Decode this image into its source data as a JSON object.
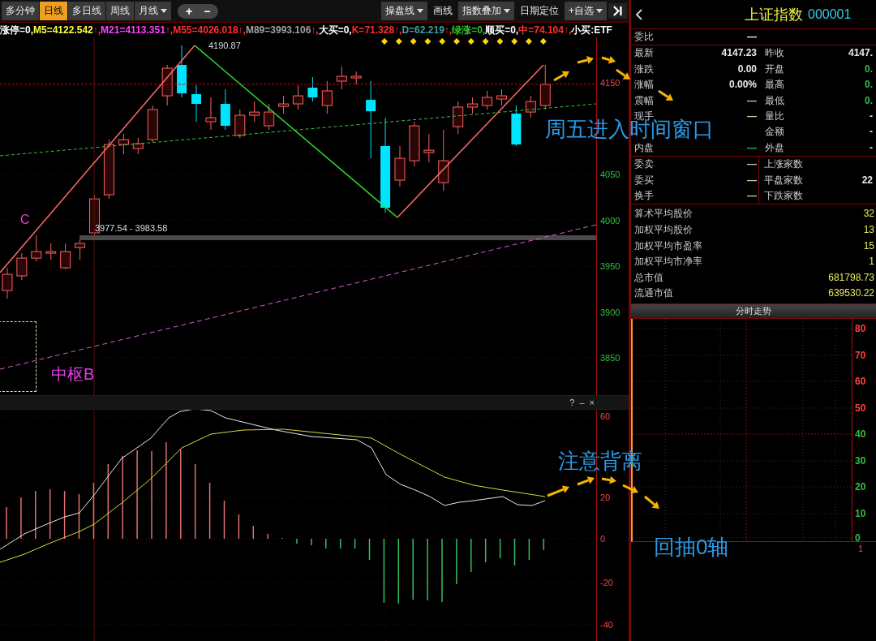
{
  "toolbar": {
    "period_tabs": [
      {
        "label": "多分钟",
        "selected": false,
        "dropdown": false
      },
      {
        "label": "日线",
        "selected": true,
        "dropdown": false
      },
      {
        "label": "多日线",
        "selected": false,
        "dropdown": false
      },
      {
        "label": "周线",
        "selected": false,
        "dropdown": false
      },
      {
        "label": "月线",
        "selected": false,
        "dropdown": true
      }
    ],
    "zoom_buttons": [
      "+",
      "−"
    ],
    "tools": [
      {
        "label": "操盘线",
        "dropdown": true
      },
      {
        "label": "画线",
        "dropdown": false
      },
      {
        "label": "指数叠加",
        "dropdown": true
      },
      {
        "label": "日期定位",
        "dropdown": false
      },
      {
        "label": "+自选",
        "dropdown": true
      }
    ]
  },
  "indicators": [
    {
      "text": "涨停=0,",
      "color": "#ffffff"
    },
    {
      "text": "M5=4122.542",
      "color": "#ffff40",
      "trend": "↑,"
    },
    {
      "text": "M21=4113.351",
      "color": "#ff40ff",
      "trend": "↑,"
    },
    {
      "text": "M55=4026.018",
      "color": "#ff3030",
      "trend": "↑,"
    },
    {
      "text": "M89=3993.106",
      "color": "#a0a0a0",
      "trend": "↑,"
    },
    {
      "text": "大买=0,",
      "color": "#ffffff"
    },
    {
      "text": "K=71.328",
      "color": "#ff3030",
      "trend": "↑,"
    },
    {
      "text": "D=62.219",
      "color": "#40a0a0",
      "trend": "↑,"
    },
    {
      "text": "绿涨=0,",
      "color": "#30c030"
    },
    {
      "text": "顺买=0,",
      "color": "#ffffff"
    },
    {
      "text": "中=74.104",
      "color": "#ff3030",
      "trend": "↑,"
    },
    {
      "text": "小买:",
      "color": "#ffffff"
    },
    {
      "text": "ETF",
      "color": "#ffffff"
    }
  ],
  "price_chart": {
    "high_label": "4190.87",
    "range_label": "3977.54 - 3983.58",
    "chart_data": {
      "type": "candlestick",
      "categories": [
        null,
        null,
        null,
        null,
        null,
        null,
        null,
        null,
        null,
        null,
        null,
        null,
        null,
        null,
        null,
        null,
        null,
        null,
        null,
        null,
        null,
        null,
        null,
        null,
        null,
        null,
        null,
        null,
        null,
        null,
        null,
        null,
        null,
        null,
        null,
        null,
        null,
        null,
        null,
        null,
        null
      ],
      "ohlc": [
        [
          3923.4,
          3948.2,
          3914.6,
          3941.1
        ],
        [
          3939.4,
          3964.1,
          3934.9,
          3958.8
        ],
        [
          3958.8,
          3983.6,
          3955.3,
          3965.9
        ],
        [
          3964.1,
          3974.8,
          3957.1,
          3965.9
        ],
        [
          3948.2,
          3974.8,
          3946.4,
          3965.9
        ],
        [
          3970.3,
          3979.2,
          3957.1,
          3974.8
        ],
        [
          3986.3,
          4027.9,
          3983.6,
          4023.4
        ],
        [
          4027.9,
          4088.0,
          4023.4,
          4082.7
        ],
        [
          4082.7,
          4094.2,
          4072.1,
          4088.0
        ],
        [
          4078.3,
          4089.8,
          4072.1,
          4083.6
        ],
        [
          4088.0,
          4125.2,
          4085.4,
          4120.8
        ],
        [
          4135.8,
          4169.5,
          4125.2,
          4165.9
        ],
        [
          4169.5,
          4190.87,
          4134.1,
          4138.5
        ],
        [
          4137.6,
          4147.3,
          4107.5,
          4127.0
        ],
        [
          4107.5,
          4134.1,
          4098.7,
          4111.9
        ],
        [
          4127.0,
          4142.9,
          4098.7,
          4103.1
        ],
        [
          4092.5,
          4120.8,
          4089.8,
          4114.6
        ],
        [
          4114.6,
          4129.6,
          4107.5,
          4118.1
        ],
        [
          4103.1,
          4127.0,
          4098.7,
          4118.1
        ],
        [
          4124.3,
          4135.8,
          4116.4,
          4127.0
        ],
        [
          4127.0,
          4147.3,
          4120.8,
          4135.8
        ],
        [
          4144.7,
          4156.2,
          4129.6,
          4134.1
        ],
        [
          4125.2,
          4151.8,
          4116.4,
          4141.2
        ],
        [
          4151.8,
          4167.7,
          4142.9,
          4157.1
        ],
        [
          4155.3,
          4162.4,
          4148.2,
          4157.1
        ],
        [
          4131.4,
          4151.8,
          4067.7,
          4119.0
        ],
        [
          4081.0,
          4111.9,
          4008.4,
          4013.7
        ],
        [
          4043.8,
          4081.0,
          4036.7,
          4067.7
        ],
        [
          4065.0,
          4107.5,
          4058.8,
          4103.1
        ],
        [
          4073.9,
          4094.2,
          4063.3,
          4076.5
        ],
        [
          4041.1,
          4098.7,
          4032.3,
          4065.0
        ],
        [
          4102.2,
          4129.6,
          4094.2,
          4123.5
        ],
        [
          4123.5,
          4134.1,
          4116.4,
          4127.0
        ],
        [
          4125.2,
          4141.2,
          4120.8,
          4134.1
        ],
        [
          4132.3,
          4142.9,
          4125.2,
          4135.8
        ],
        [
          4116.4,
          4125.2,
          4081.0,
          4082.7
        ],
        [
          4118.1,
          4135.8,
          4111.9,
          4129.6
        ],
        [
          4125.2,
          4169.5,
          4120.8,
          4148.2
        ],
        null,
        null,
        null
      ],
      "grid": true,
      "ylim": [
        3809.3,
        4199.6
      ],
      "yticks": [
        4150,
        4050,
        4000,
        3950,
        3900,
        3850
      ]
    }
  },
  "macd_panel": {
    "controls": [
      "?",
      "–",
      "×"
    ],
    "axis": [
      "60",
      "20",
      "0",
      "-20",
      "-40"
    ]
  },
  "annotations": [
    {
      "text": "C",
      "color": "#e040e0"
    },
    {
      "text": "中枢B",
      "color": "#e040e0"
    },
    {
      "text": "周五进入时间窗口",
      "color": "#2a9be8"
    },
    {
      "text": "注意背离",
      "color": "#2a9be8"
    },
    {
      "text": "回抽0轴",
      "color": "#2a9be8"
    }
  ],
  "quote_panel": {
    "title": "上证指数",
    "code": "000001",
    "ratio": {
      "label": "委比",
      "value": "—"
    },
    "rows": [
      {
        "left": {
          "label": "最新",
          "value": "4147.23",
          "color": "#e8e8e8"
        },
        "right": {
          "label": "昨收",
          "value": "4147.",
          "color": "#e8e8e8"
        }
      },
      {
        "left": {
          "label": "涨跌",
          "value": "0.00",
          "color": "#e8e8e8"
        },
        "right": {
          "label": "开盘",
          "value": "0.",
          "color": "#30c040"
        }
      },
      {
        "left": {
          "label": "涨幅",
          "value": "0.00%",
          "color": "#e8e8e8"
        },
        "right": {
          "label": "最高",
          "value": "0.",
          "color": "#30c040"
        }
      },
      {
        "left": {
          "label": "震幅",
          "value": "—",
          "color": "#c8c890"
        },
        "right": {
          "label": "最低",
          "value": "0.",
          "color": "#30c040"
        }
      },
      {
        "left": {
          "label": "现手",
          "value": "—",
          "color": "#c8c890"
        },
        "right": {
          "label": "量比",
          "value": "-"
        }
      },
      {
        "right": {
          "label": "金额",
          "value": "-"
        }
      },
      {
        "left": {
          "label": "内盘",
          "value": "—",
          "color": "#30c040"
        },
        "right": {
          "label": "外盘",
          "value": "-"
        }
      }
    ],
    "orders": [
      {
        "left": {
          "label": "委卖",
          "value": "—"
        },
        "right": {
          "label": "上涨家数"
        }
      },
      {
        "left": {
          "label": "委买",
          "value": "—"
        },
        "right": {
          "label": "平盘家数",
          "value": "22"
        }
      },
      {
        "left": {
          "label": "换手",
          "value": "—"
        },
        "right": {
          "label": "下跌家数"
        }
      }
    ],
    "stats": [
      {
        "label": "算术平均股价",
        "value": "32"
      },
      {
        "label": "加权平均股价",
        "value": "13"
      },
      {
        "label": "加权平均市盈率",
        "value": "15"
      },
      {
        "label": "加权平均市净率",
        "value": "1"
      },
      {
        "label": "总市值",
        "value": "681798.73"
      },
      {
        "label": "流通市值",
        "value": "639530.22"
      }
    ],
    "intraday": {
      "title": "分时走势",
      "axis": [
        {
          "label": "80",
          "color": "#ff4040"
        },
        {
          "label": "70",
          "color": "#ff4040"
        },
        {
          "label": "60",
          "color": "#ff4040"
        },
        {
          "label": "50",
          "color": "#ff4040"
        },
        {
          "label": "40",
          "color": "#30c040"
        },
        {
          "label": "30",
          "color": "#30c040"
        },
        {
          "label": "20",
          "color": "#30c040"
        },
        {
          "label": "10",
          "color": "#30c040"
        },
        {
          "label": "0",
          "color": "#30c040"
        }
      ],
      "lower_tick": "1"
    }
  }
}
